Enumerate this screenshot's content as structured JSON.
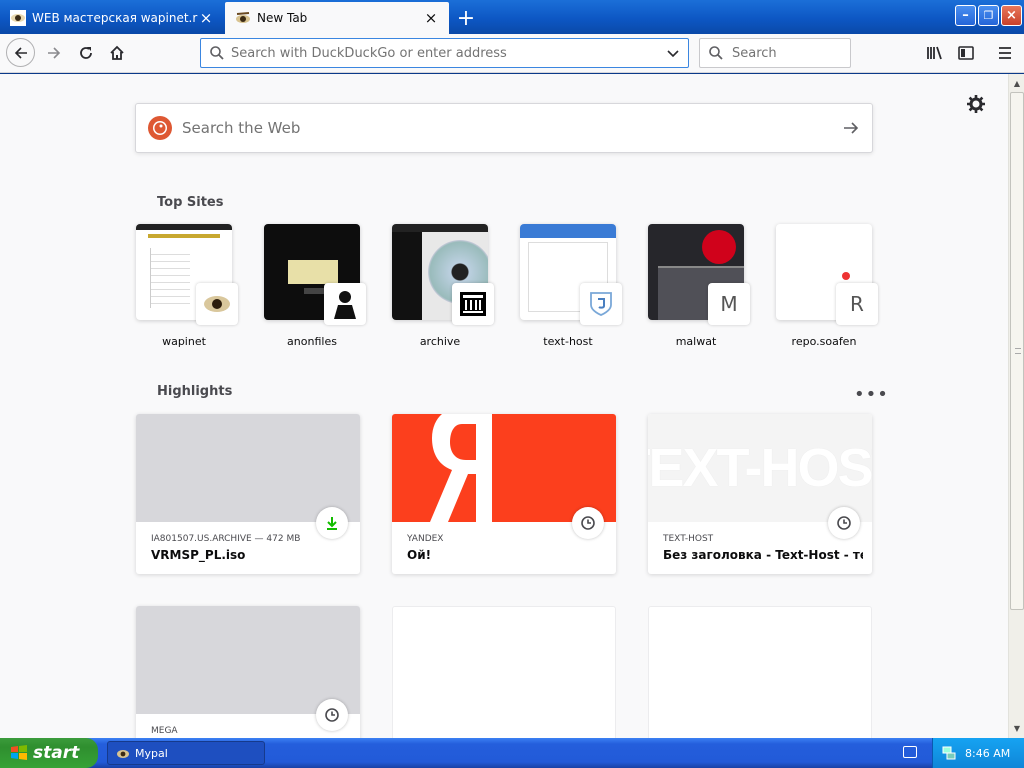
{
  "browser": {
    "tabs": [
      {
        "title": "WEB мастерская wapinet.ru",
        "close": "×",
        "active": false
      },
      {
        "title": "New Tab",
        "close": "×",
        "active": true
      }
    ],
    "new_tab_glyph": "+"
  },
  "window_controls": {
    "minimize": "–",
    "restore": "❐",
    "close": "×"
  },
  "toolbar": {
    "url_placeholder": "Search with DuckDuckGo or enter address",
    "search_placeholder": "Search"
  },
  "newtab": {
    "search_placeholder": "Search the Web",
    "top_sites_heading": "Top Sites",
    "top_sites": [
      {
        "label": "wapinet",
        "overlay": ""
      },
      {
        "label": "anonfiles",
        "overlay": ""
      },
      {
        "label": "archive",
        "overlay": ""
      },
      {
        "label": "text-host",
        "overlay": ""
      },
      {
        "label": "malwat",
        "overlay": "M"
      },
      {
        "label": "repo.soafen",
        "overlay": "R"
      }
    ],
    "highlights_heading": "Highlights",
    "highlights_menu": "•••",
    "highlights": [
      {
        "source": "IA801507.US.ARCHIVE — 472 MB",
        "title": "VRMSP_PL.iso",
        "badge": "download-icon"
      },
      {
        "source": "YANDEX",
        "title": "Ой!",
        "badge": "clock-icon"
      },
      {
        "source": "TEXT-HOST",
        "title": "Без заголовка - Text-Host - тек...",
        "badge": "clock-icon"
      },
      {
        "source": "MEGA",
        "title": "",
        "badge": "clock-icon"
      }
    ],
    "preview_text_texthost": "TEXT-HOST"
  },
  "taskbar": {
    "start_label": "start",
    "task_label": "Mypal",
    "clock": "8:46 AM"
  },
  "colors": {
    "accent": "#3b86e0",
    "yandex_red": "#fc3f1d",
    "download_green": "#12bc00",
    "xp_blue": "#245edc",
    "xp_green": "#36a236"
  }
}
